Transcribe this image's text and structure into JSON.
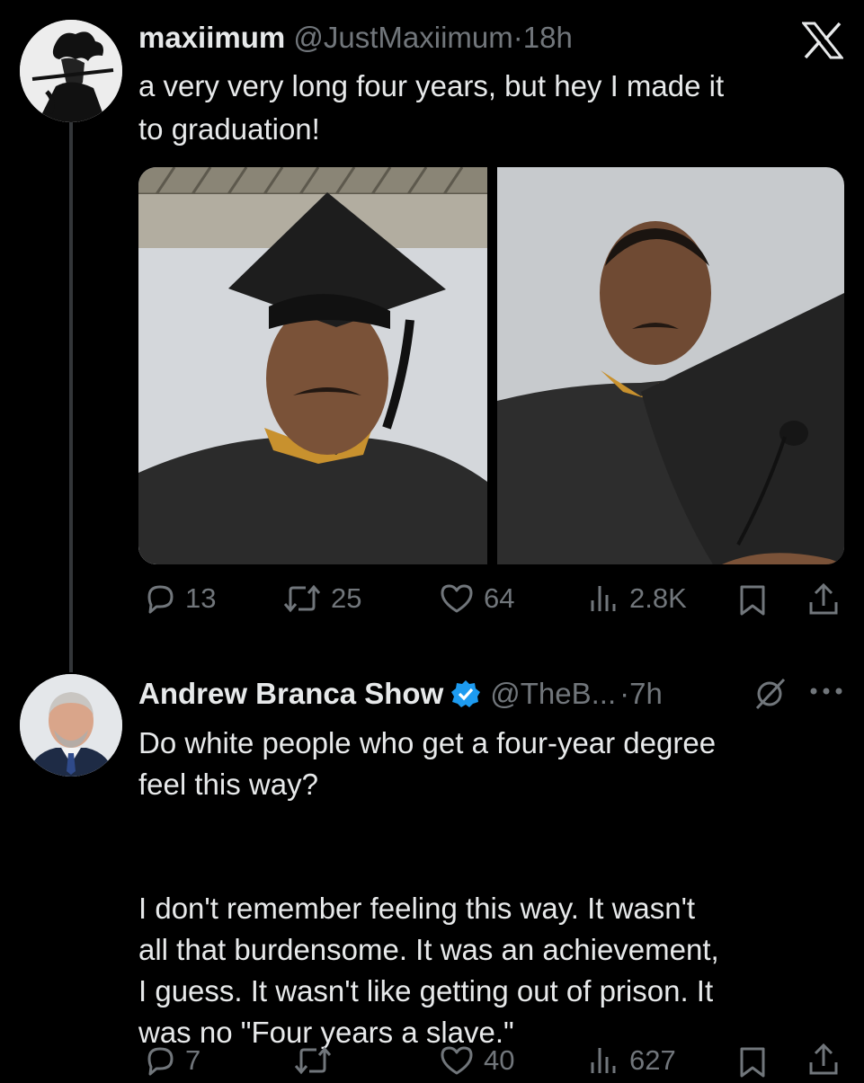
{
  "tweet1": {
    "display_name": "maxiimum",
    "handle": "@JustMaxiimum",
    "separator": "·",
    "time": "18h",
    "text": "a very very long four years, but hey I made it\nto graduation!",
    "platform_icon": "x-logo-icon",
    "actions": {
      "replies": "13",
      "retweets": "25",
      "likes": "64",
      "views": "2.8K"
    }
  },
  "tweet2": {
    "display_name": "Andrew Branca Show",
    "handle": "@TheB...",
    "separator": "·",
    "time": "7h",
    "verified": true,
    "text": "Do white people who get a four-year degree\nfeel this way?\n\n\nI don't remember feeling this way. It wasn't\nall that burdensome. It was an achievement,\nI guess. It wasn't like getting out of prison. It\nwas no \"Four years a slave.\"",
    "actions": {
      "replies": "7",
      "likes": "40",
      "views": "627"
    }
  },
  "colors": {
    "background": "#000000",
    "text": "#e7e9ea",
    "muted": "#71767b",
    "verified": "#1d9bf0",
    "thread_line": "#333639"
  }
}
